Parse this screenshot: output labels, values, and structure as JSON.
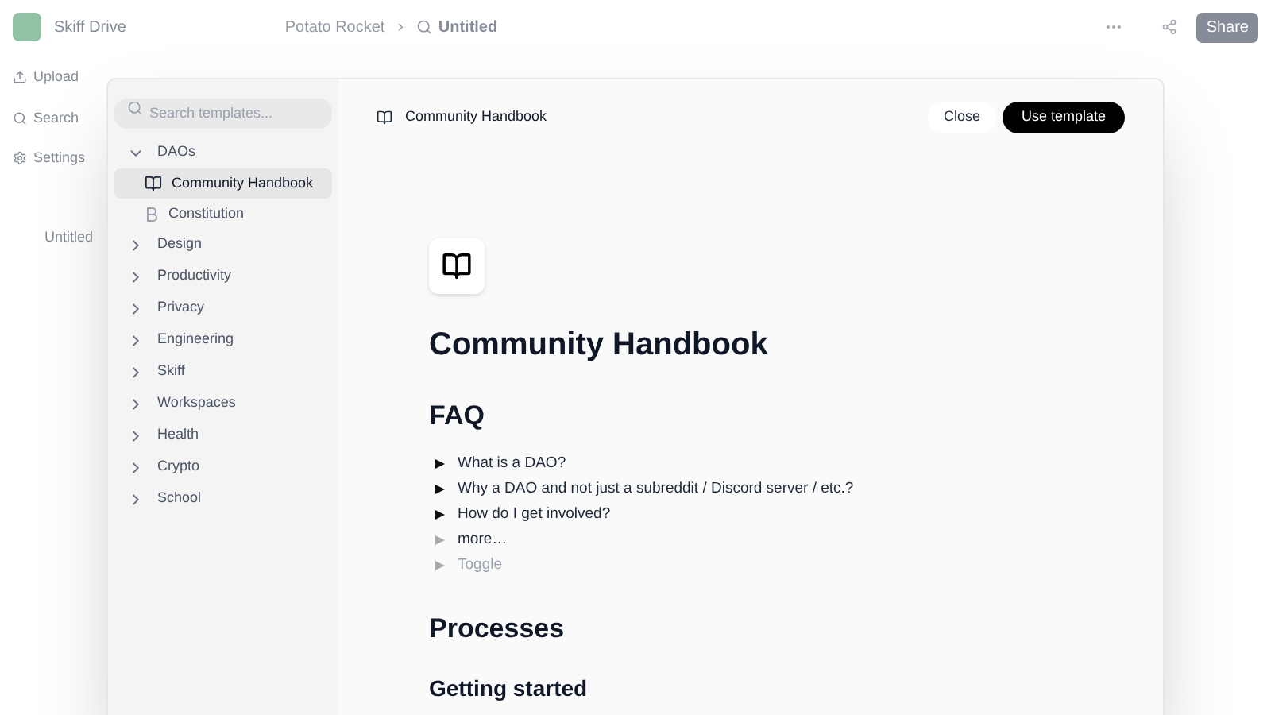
{
  "background": {
    "app_title": "Skiff Drive",
    "nav": [
      "Upload",
      "Search",
      "Settings"
    ],
    "tree_item": "Untitled",
    "breadcrumb": [
      "Potato Rocket",
      "Untitled"
    ],
    "separator": "›",
    "share": "Share"
  },
  "modal": {
    "search": {
      "placeholder": "Search templates..."
    },
    "categories": [
      {
        "label": "DAOs",
        "expanded": true,
        "children": [
          {
            "label": "Community Handbook",
            "kind": "book",
            "selected": true
          },
          {
            "label": "Constitution",
            "kind": "letter",
            "selected": false
          }
        ]
      },
      {
        "label": "Design",
        "expanded": false
      },
      {
        "label": "Productivity",
        "expanded": false
      },
      {
        "label": "Privacy",
        "expanded": false
      },
      {
        "label": "Engineering",
        "expanded": false
      },
      {
        "label": "Skiff",
        "expanded": false
      },
      {
        "label": "Workspaces",
        "expanded": false
      },
      {
        "label": "Health",
        "expanded": false
      },
      {
        "label": "Crypto",
        "expanded": false
      },
      {
        "label": "School",
        "expanded": false
      }
    ],
    "header_title": "Community Handbook",
    "buttons": {
      "close": "Close",
      "use": "Use template"
    },
    "doc": {
      "title": "Community Handbook",
      "sections": [
        {
          "kind": "h2",
          "text": "FAQ"
        },
        {
          "kind": "toggles",
          "items": [
            {
              "text": "What is a DAO?",
              "has_content": true,
              "empty": false
            },
            {
              "text": "Why a DAO and not just a subreddit / Discord server / etc.?",
              "has_content": true,
              "empty": false
            },
            {
              "text": "How do I get involved?",
              "has_content": true,
              "empty": false
            },
            {
              "text": "more…",
              "has_content": false,
              "empty": false
            },
            {
              "text": "Toggle",
              "has_content": false,
              "empty": true
            }
          ]
        },
        {
          "kind": "h2",
          "text": "Processes"
        },
        {
          "kind": "h3",
          "text": "Getting started"
        }
      ]
    }
  }
}
